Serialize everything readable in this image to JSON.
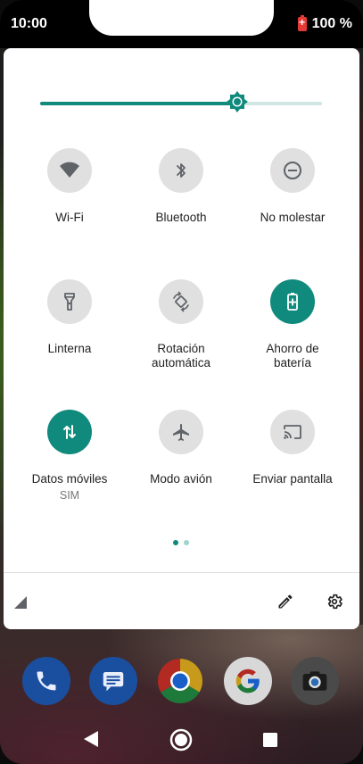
{
  "status_bar": {
    "time": "10:00",
    "battery": "100 %"
  },
  "brightness": {
    "level_fraction": 0.7,
    "accent_color": "#0f8a7c"
  },
  "tiles": [
    {
      "label": "Wi-Fi",
      "icon": "wifi-icon",
      "active": false
    },
    {
      "label": "Bluetooth",
      "icon": "bluetooth-icon",
      "active": false
    },
    {
      "label": "No molestar",
      "icon": "do-not-disturb-icon",
      "active": false
    },
    {
      "label": "Linterna",
      "icon": "flashlight-icon",
      "active": false
    },
    {
      "label": "Rotación\nautomática",
      "icon": "auto-rotate-icon",
      "active": false
    },
    {
      "label": "Ahorro de\nbatería",
      "icon": "battery-saver-icon",
      "active": true
    },
    {
      "label": "Datos móviles",
      "sub": "SIM",
      "icon": "mobile-data-icon",
      "active": true
    },
    {
      "label": "Modo avión",
      "icon": "airplane-icon",
      "active": false
    },
    {
      "label": "Enviar pantalla",
      "icon": "cast-icon",
      "active": false
    }
  ],
  "pager": {
    "pages": 2,
    "current": 1
  },
  "dock": {
    "apps": [
      "phone-icon",
      "messages-icon",
      "chrome-icon",
      "google-icon",
      "camera-icon"
    ]
  },
  "colors": {
    "accent": "#0f8a7c",
    "tile_inactive": "#e0e0e0",
    "icon_inactive": "#5f6368"
  }
}
